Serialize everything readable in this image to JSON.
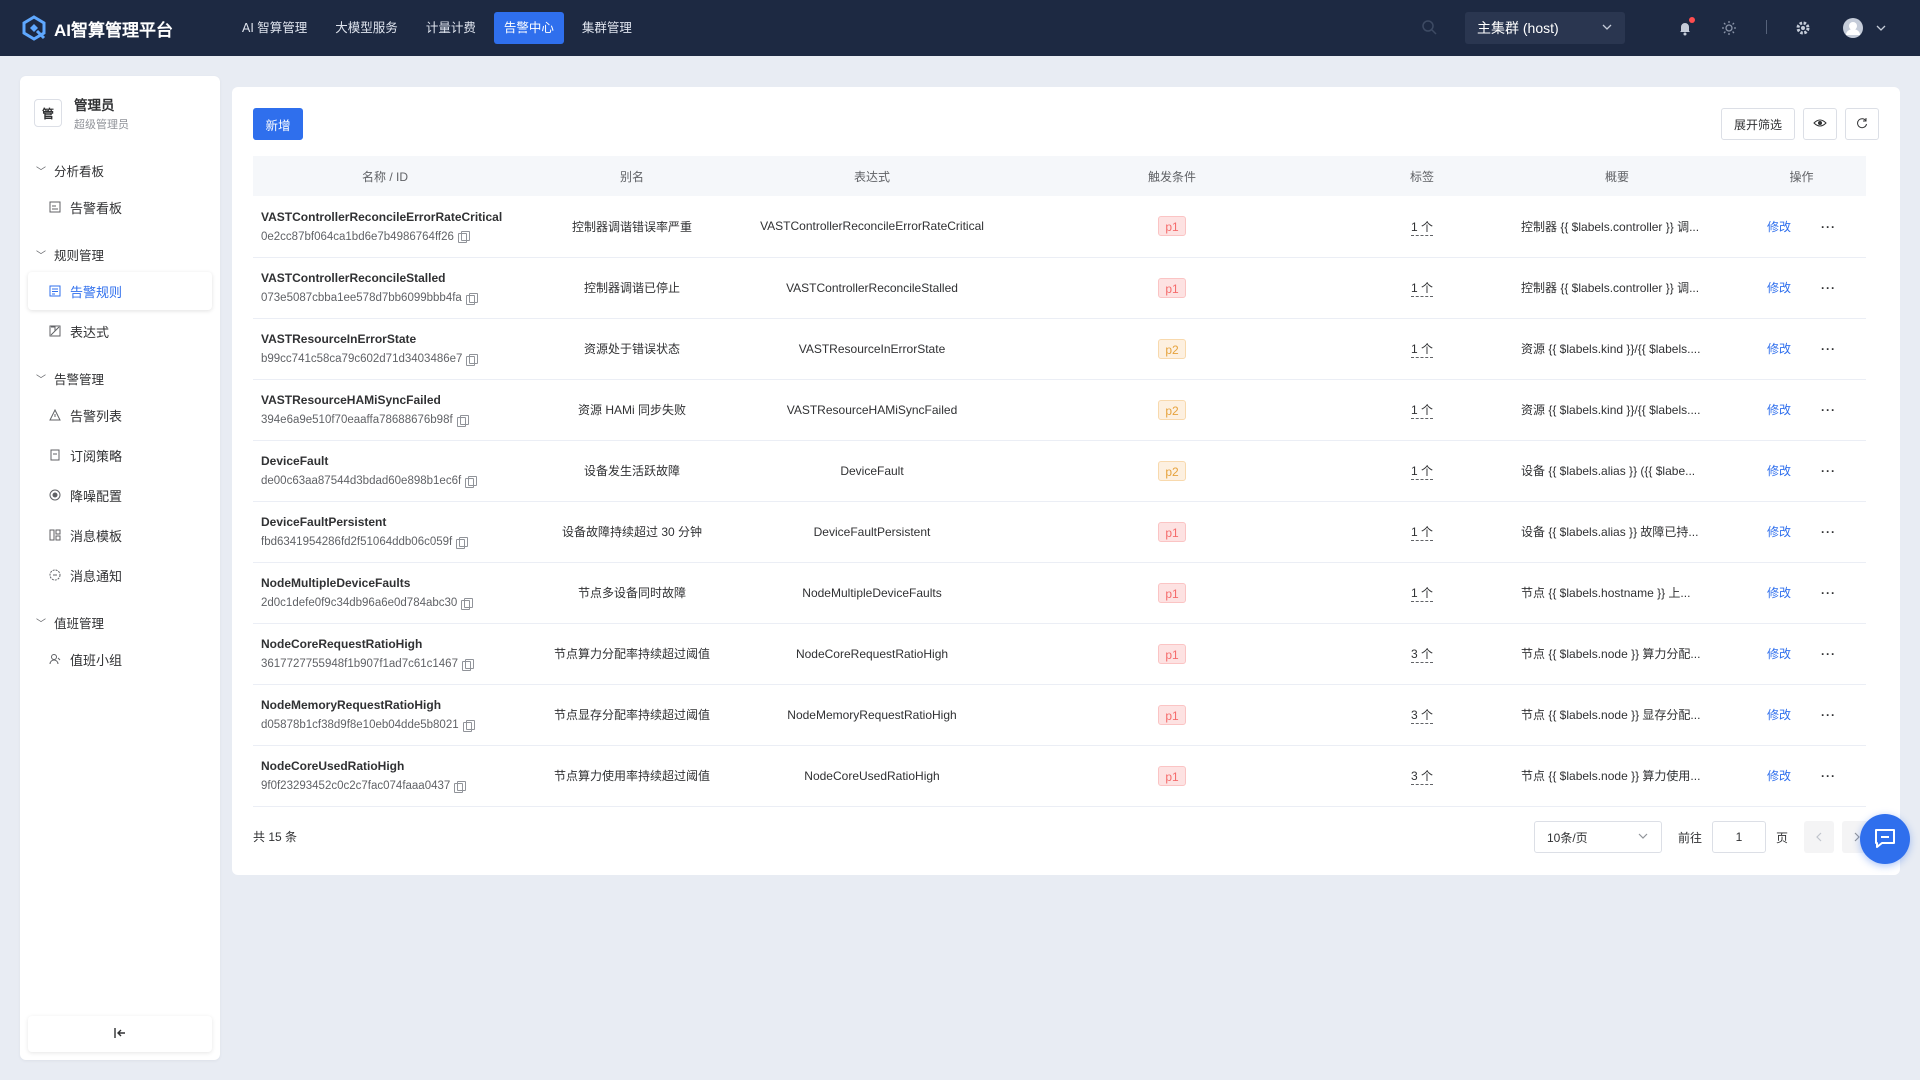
{
  "app": {
    "title": "AI智算管理平台"
  },
  "nav": {
    "items": [
      "AI 智算管理",
      "大模型服务",
      "计量计费",
      "告警中心",
      "集群管理"
    ],
    "active_index": 3
  },
  "cluster": {
    "selected": "主集群 (host)"
  },
  "user": {
    "avatar_text": "管",
    "name": "管理员",
    "role": "超级管理员"
  },
  "sidebar": {
    "sections": [
      {
        "title": "分析看板",
        "items": [
          {
            "label": "告警看板",
            "icon": "dashboard-icon"
          }
        ]
      },
      {
        "title": "规则管理",
        "items": [
          {
            "label": "告警规则",
            "icon": "rules-icon",
            "active": true
          },
          {
            "label": "表达式",
            "icon": "expression-icon"
          }
        ]
      },
      {
        "title": "告警管理",
        "items": [
          {
            "label": "告警列表",
            "icon": "warning-icon"
          },
          {
            "label": "订阅策略",
            "icon": "subscription-icon"
          },
          {
            "label": "降噪配置",
            "icon": "noise-icon"
          },
          {
            "label": "消息模板",
            "icon": "template-icon"
          },
          {
            "label": "消息通知",
            "icon": "notification-icon"
          }
        ]
      },
      {
        "title": "值班管理",
        "items": [
          {
            "label": "值班小组",
            "icon": "team-icon"
          }
        ]
      }
    ],
    "collapse_icon": "collapse-sidebar-icon"
  },
  "toolbar": {
    "add_label": "新增",
    "filter_label": "展开筛选"
  },
  "table": {
    "columns": [
      "名称 / ID",
      "别名",
      "表达式",
      "触发条件",
      "标签",
      "概要",
      "操作"
    ],
    "edit_label": "修改",
    "more_label": "···",
    "rows": [
      {
        "name": "VASTControllerReconcileErrorRateCritical",
        "id": "0e2cc87bf064ca1bd6e7b4986764ff26",
        "alias": "控制器调谐错误率严重",
        "expr": "VASTControllerReconcileErrorRateCritical",
        "level": "p1",
        "tags": "1 个",
        "summary": "控制器 {{ $labels.controller }} 调..."
      },
      {
        "name": "VASTControllerReconcileStalled",
        "id": "073e5087cbba1ee578d7bb6099bbb4fa",
        "alias": "控制器调谐已停止",
        "expr": "VASTControllerReconcileStalled",
        "level": "p1",
        "tags": "1 个",
        "summary": "控制器 {{ $labels.controller }} 调..."
      },
      {
        "name": "VASTResourceInErrorState",
        "id": "b99cc741c58ca79c602d71d3403486e7",
        "alias": "资源处于错误状态",
        "expr": "VASTResourceInErrorState",
        "level": "p2",
        "tags": "1 个",
        "summary": "资源 {{ $labels.kind }}/{{ $labels...."
      },
      {
        "name": "VASTResourceHAMiSyncFailed",
        "id": "394e6a9e510f70eaaffa78688676b98f",
        "alias": "资源 HAMi 同步失败",
        "expr": "VASTResourceHAMiSyncFailed",
        "level": "p2",
        "tags": "1 个",
        "summary": "资源 {{ $labels.kind }}/{{ $labels...."
      },
      {
        "name": "DeviceFault",
        "id": "de00c63aa87544d3bdad60e898b1ec6f",
        "alias": "设备发生活跃故障",
        "expr": "DeviceFault",
        "level": "p2",
        "tags": "1 个",
        "summary": "设备 {{ $labels.alias }} ({{ $labe..."
      },
      {
        "name": "DeviceFaultPersistent",
        "id": "fbd6341954286fd2f51064ddb06c059f",
        "alias": "设备故障持续超过 30 分钟",
        "expr": "DeviceFaultPersistent",
        "level": "p1",
        "tags": "1 个",
        "summary": "设备 {{ $labels.alias }} 故障已持..."
      },
      {
        "name": "NodeMultipleDeviceFaults",
        "id": "2d0c1defe0f9c34db96a6e0d784abc30",
        "alias": "节点多设备同时故障",
        "expr": "NodeMultipleDeviceFaults",
        "level": "p1",
        "tags": "1 个",
        "summary": "节点 {{ $labels.hostname }} 上..."
      },
      {
        "name": "NodeCoreRequestRatioHigh",
        "id": "3617727755948f1b907f1ad7c61c1467",
        "alias": "节点算力分配率持续超过阈值",
        "expr": "NodeCoreRequestRatioHigh",
        "level": "p1",
        "tags": "3 个",
        "summary": "节点 {{ $labels.node }} 算力分配..."
      },
      {
        "name": "NodeMemoryRequestRatioHigh",
        "id": "d05878b1cf38d9f8e10eb04dde5b8021",
        "alias": "节点显存分配率持续超过阈值",
        "expr": "NodeMemoryRequestRatioHigh",
        "level": "p1",
        "tags": "3 个",
        "summary": "节点 {{ $labels.node }} 显存分配..."
      },
      {
        "name": "NodeCoreUsedRatioHigh",
        "id": "9f0f23293452c0c2c7fac074faaa0437",
        "alias": "节点算力使用率持续超过阈值",
        "expr": "NodeCoreUsedRatioHigh",
        "level": "p1",
        "tags": "3 个",
        "summary": "节点 {{ $labels.node }} 算力使用..."
      }
    ]
  },
  "pagination": {
    "total": "共 15 条",
    "page_size": "10条/页",
    "goto_label": "前往",
    "page_value": "1",
    "page_suffix": "页"
  },
  "colors": {
    "topbar": "#1d2942",
    "accent": "#2f6fed",
    "p1": "#f56c6c",
    "p2": "#e6a23c"
  }
}
